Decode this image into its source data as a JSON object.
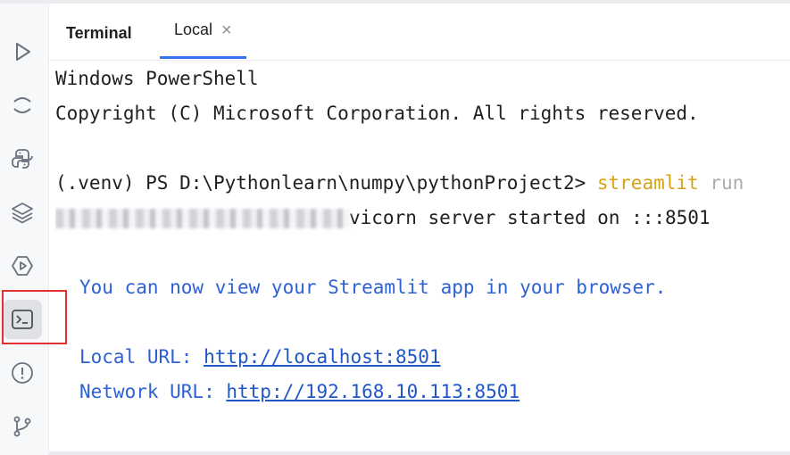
{
  "tabs": {
    "title": "Terminal",
    "active_tab": "Local",
    "close_glyph": "×"
  },
  "sidebar": {
    "icons": [
      "run-icon",
      "debug-icon",
      "python-console-icon",
      "layers-icon",
      "services-icon",
      "terminal-icon",
      "problems-icon",
      "git-icon"
    ],
    "active": "terminal-icon"
  },
  "terminal": {
    "line1": "Windows PowerShell",
    "line2": "Copyright (C) Microsoft Corporation. All rights reserved.",
    "prompt": "(.venv) PS D:\\Pythonlearn\\numpy\\pythonProject2> ",
    "command": "streamlit",
    "command_rest": " run",
    "log_text": "vicorn server started on :::8501",
    "view_msg": "You can now view your Streamlit app in your browser.",
    "local_label": "Local URL: ",
    "local_url": "http://localhost:8501",
    "network_label": "Network URL: ",
    "network_url": "http://192.168.10.113:8501"
  },
  "colors": {
    "accent": "#3574f0",
    "highlight_box": "#e03131",
    "command": "#d6a317",
    "info_blue": "#2e61d6"
  }
}
